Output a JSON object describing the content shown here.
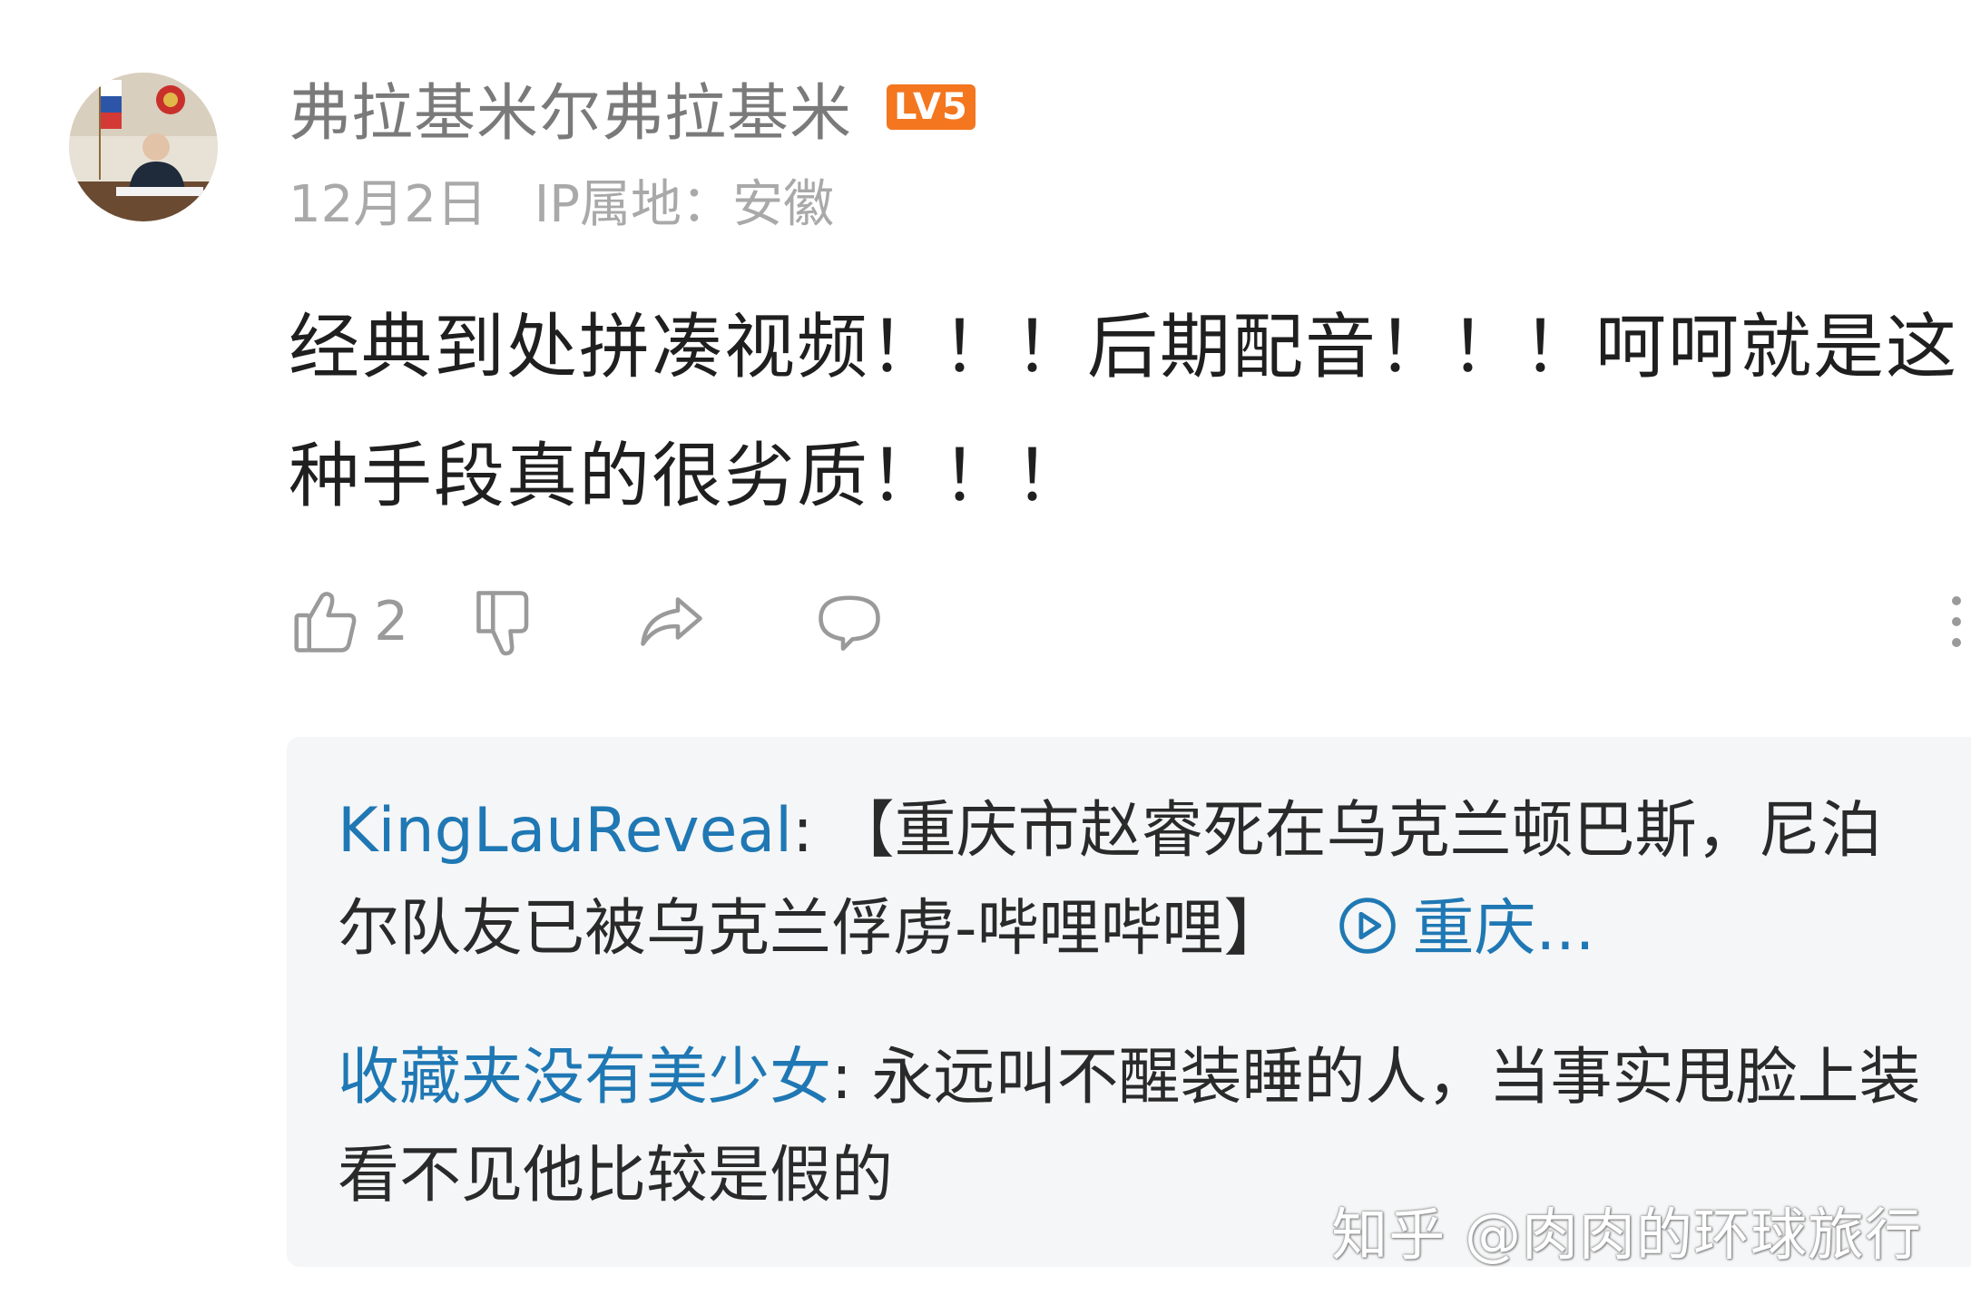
{
  "comment": {
    "author": "弗拉基米尔弗拉基米",
    "level": "LV5",
    "date": "12月2日",
    "ip_location": "IP属地：安徽",
    "text": "经典到处拼凑视频！！！后期配音！！！呵呵就是这种手段真的很劣质！！！",
    "likes": "2"
  },
  "icons": {
    "like": "thumbs-up-icon",
    "dislike": "thumbs-down-icon",
    "share": "share-icon",
    "reply": "comment-bubble-icon",
    "more": "more-vertical-icon",
    "video": "play-circle-icon"
  },
  "replies": [
    {
      "user": "KingLauReveal",
      "separator": ": ",
      "text": "【重庆市赵睿死在乌克兰顿巴斯，尼泊尔队友已被乌克兰俘虏-哔哩哔哩】",
      "link_text": "重庆..."
    },
    {
      "user": "收藏夹没有美少女",
      "separator": ": ",
      "text": "永远叫不醒装睡的人，当事实甩脸上装看不见他比较是假的"
    }
  ],
  "watermark": "知乎 @肉肉的环球旅行",
  "colors": {
    "username_link": "#1f78b4",
    "level_badge": "#f4761f",
    "reply_background": "#f5f6f7"
  }
}
